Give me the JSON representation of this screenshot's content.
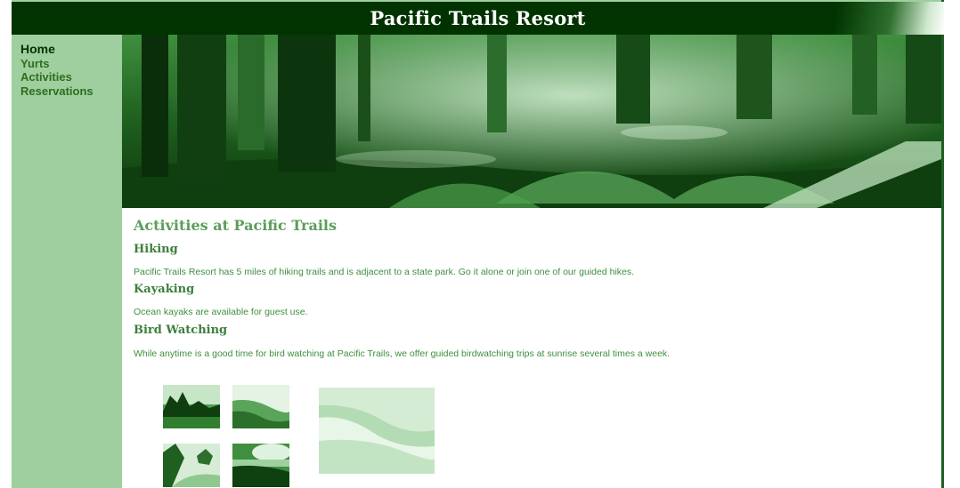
{
  "site": {
    "title": "Pacific Trails Resort"
  },
  "nav": {
    "items": [
      {
        "label": "Home"
      },
      {
        "label": "Yurts"
      },
      {
        "label": "Activities"
      },
      {
        "label": "Reservations"
      }
    ]
  },
  "main": {
    "heading": "Activities at Pacific Trails",
    "activities": [
      {
        "heading": "Hiking",
        "text": "Pacific Trails Resort has 5 miles of hiking trails and is adjacent to a state park. Go it alone or join one of our guided hikes."
      },
      {
        "heading": "Kayaking",
        "text": "Ocean kayaks are available for guest use."
      },
      {
        "heading": "Bird Watching",
        "text": "While anytime is a good time for bird watching at Pacific Trails, we offer guided birdwatching trips at sunrise several times a week."
      }
    ]
  },
  "colors": {
    "header_bg": "#003300",
    "nav_bg": "#9fcf9f",
    "nav_text": "#2e6e1e",
    "nav_active": "#003300",
    "heading": "#5a9e5a",
    "subheading": "#3c7f3c",
    "body_text": "#3d8f3d"
  }
}
